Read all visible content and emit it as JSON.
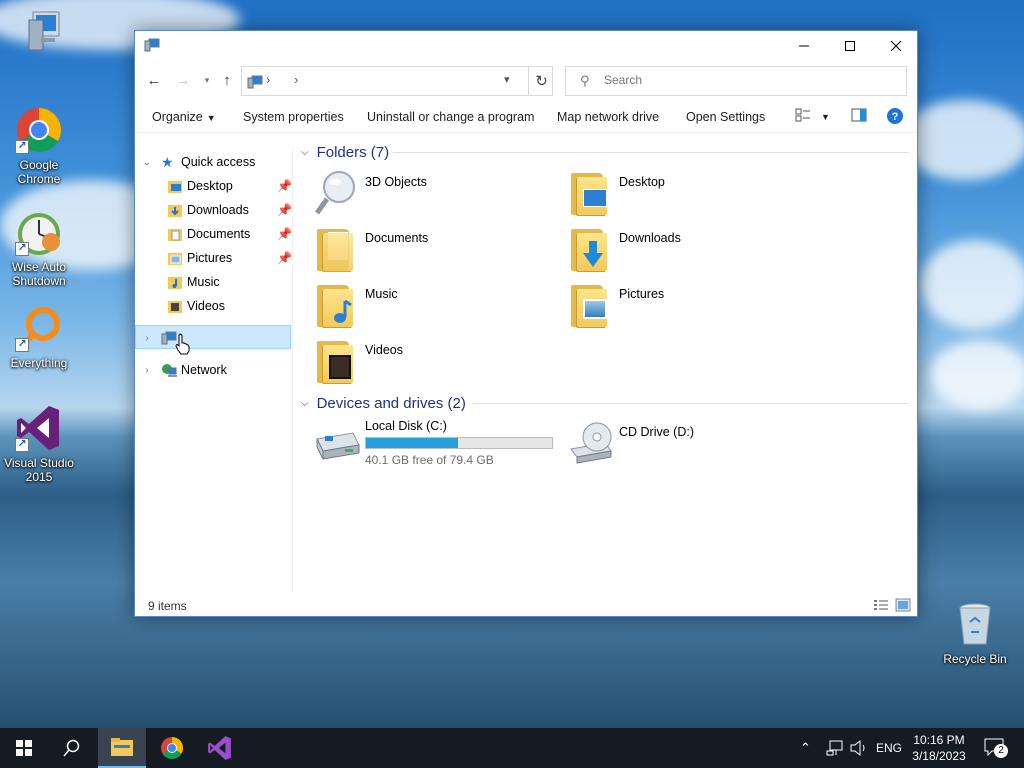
{
  "desktop": {
    "icons": [
      {
        "label": ""
      },
      {
        "label": "Google Chrome"
      },
      {
        "label": "Wise Auto Shutdown"
      },
      {
        "label": "Everything"
      },
      {
        "label": "Visual Studio 2015"
      },
      {
        "label": "Recycle Bin"
      }
    ]
  },
  "window": {
    "title": "",
    "address": {
      "crumbs": [
        "›",
        "›"
      ]
    },
    "search": {
      "placeholder": "Search"
    },
    "commands": {
      "organize": "Organize",
      "system_properties": "System properties",
      "uninstall": "Uninstall or change a program",
      "map_drive": "Map network drive",
      "open_settings": "Open Settings"
    },
    "nav": {
      "quick_access": "Quick access",
      "items": [
        "Desktop",
        "Downloads",
        "Documents",
        "Pictures",
        "Music",
        "Videos"
      ],
      "this_pc": "",
      "network": "Network"
    },
    "folders_header": "Folders (7)",
    "folders": [
      "3D Objects",
      "Desktop",
      "Documents",
      "Downloads",
      "Music",
      "Pictures",
      "Videos"
    ],
    "drives_header": "Devices and drives (2)",
    "drives": [
      {
        "name": "Local Disk (C:)",
        "free_text": "40.1 GB free of 79.4 GB",
        "used_fraction": 0.495
      },
      {
        "name": "CD Drive (D:)"
      }
    ],
    "status": {
      "count": "9 items"
    }
  },
  "taskbar": {
    "tray": {
      "lang": "ENG",
      "time": "10:16 PM",
      "date": "3/18/2023",
      "notifications": "2"
    }
  },
  "colors": {
    "accent": "#26a0da",
    "selection": "#cce8ff",
    "header": "#1e3287",
    "taskbar": "#151b22"
  }
}
